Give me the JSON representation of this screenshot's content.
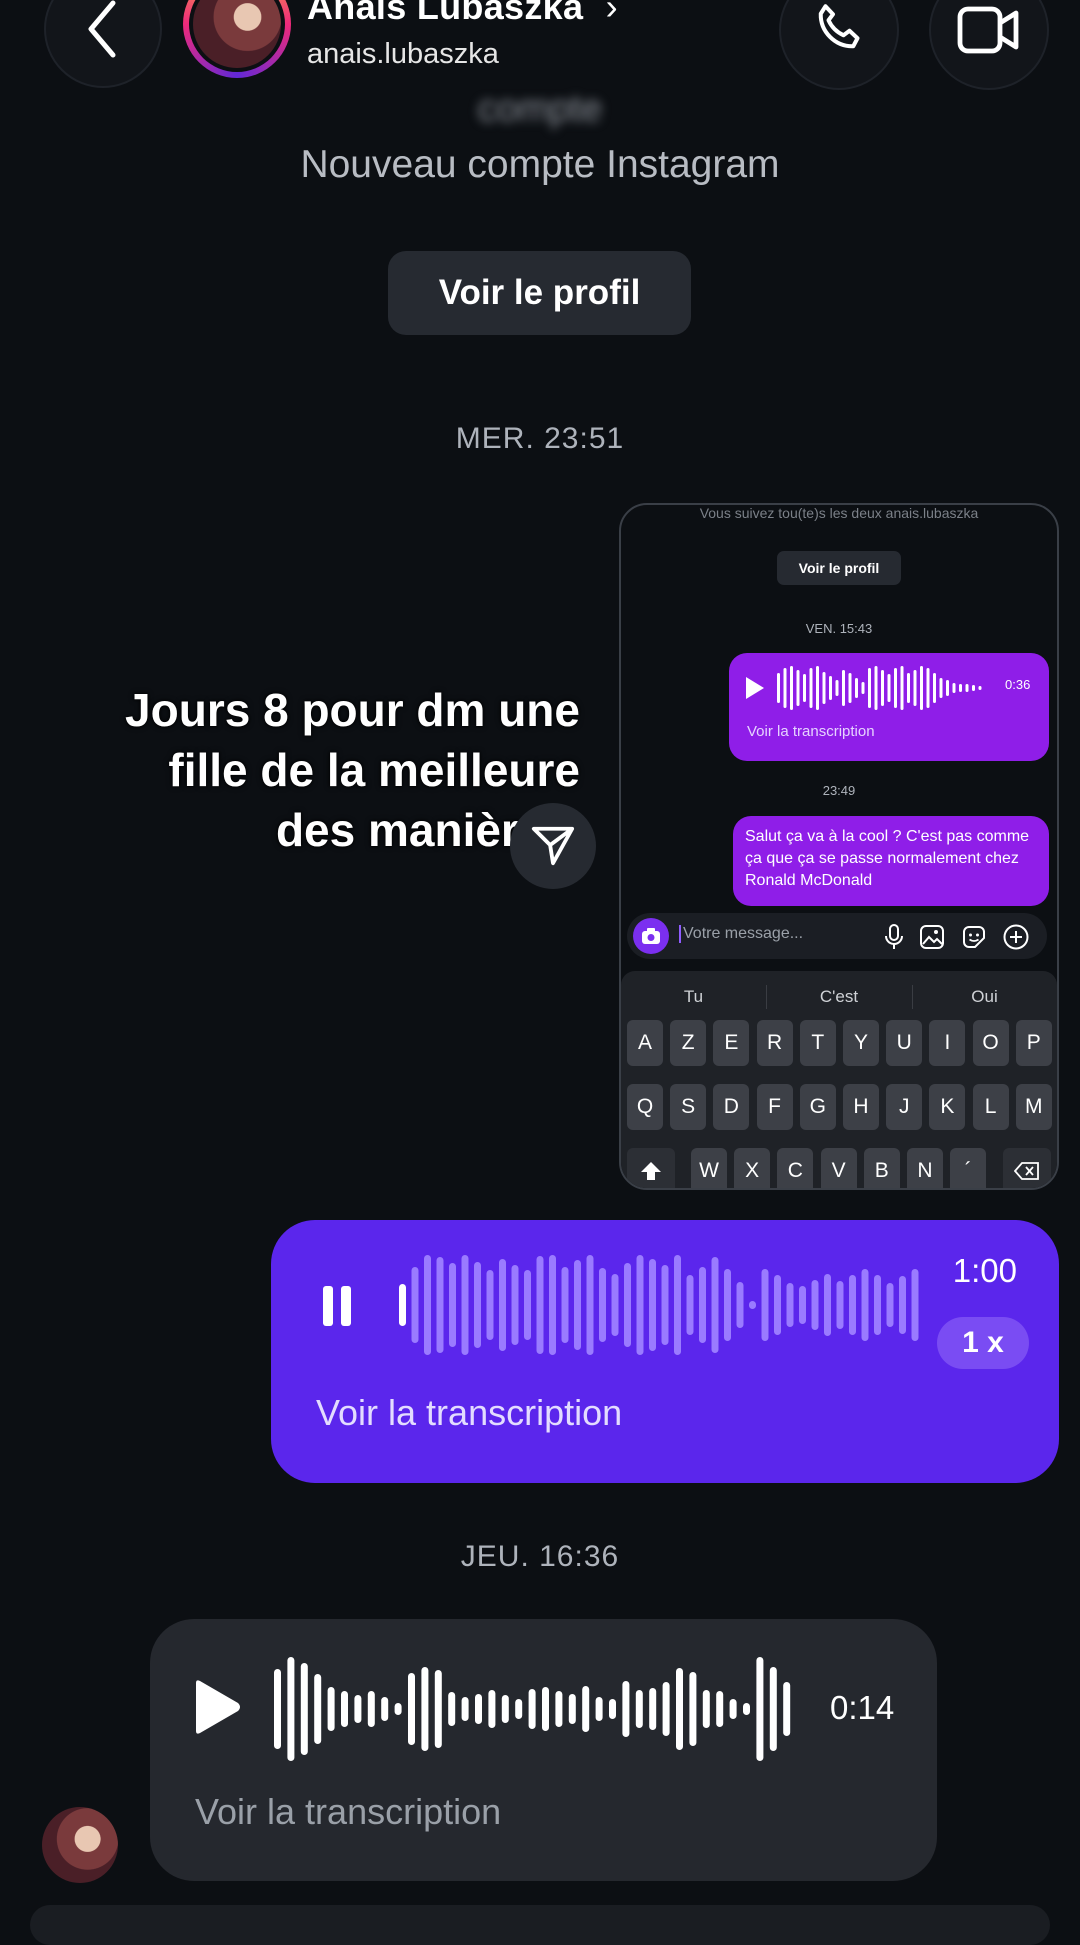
{
  "header": {
    "name": "Anais Lubaszka",
    "chevron": "›",
    "username": "anais.lubaszka",
    "icons": [
      "back-icon",
      "phone-icon",
      "video-camera-icon"
    ]
  },
  "intro": {
    "blurred_line": "compte",
    "subtitle": "Nouveau compte Instagram",
    "profile_button": "Voir le profil"
  },
  "timestamps": {
    "first": "MER. 23:51",
    "second": "JEU. 16:36"
  },
  "overlay_caption": [
    "Jours 8 pour dm une",
    "fille de la meilleure",
    "des manières"
  ],
  "mini_screenshot": {
    "top_line": "Vous suivez tou(te)s les deux anais.lubaszka",
    "profile_button": "Voir le profil",
    "timestamp_1": "VEN. 15:43",
    "voice_duration": "0:36",
    "voice_transcript": "Voir la transcription",
    "timestamp_2": "23:49",
    "text_message": "Salut ça va à la cool ? C'est pas comme ça que ça se passe normalement chez Ronald McDonald",
    "input_placeholder": "Votre message...",
    "suggestions": [
      "Tu",
      "C'est",
      "Oui"
    ],
    "keyboard_row1": [
      "A",
      "Z",
      "E",
      "R",
      "T",
      "Y",
      "U",
      "I",
      "O",
      "P"
    ],
    "keyboard_row2": [
      "Q",
      "S",
      "D",
      "F",
      "G",
      "H",
      "J",
      "K",
      "L",
      "M"
    ],
    "keyboard_row3": [
      "W",
      "X",
      "C",
      "V",
      "B",
      "N",
      "´"
    ]
  },
  "sent_voice": {
    "duration": "1:00",
    "speed": "1 x",
    "transcript": "Voir la transcription",
    "accent": "#5b26ec"
  },
  "received_voice": {
    "duration": "0:14",
    "transcript": "Voir la transcription"
  }
}
